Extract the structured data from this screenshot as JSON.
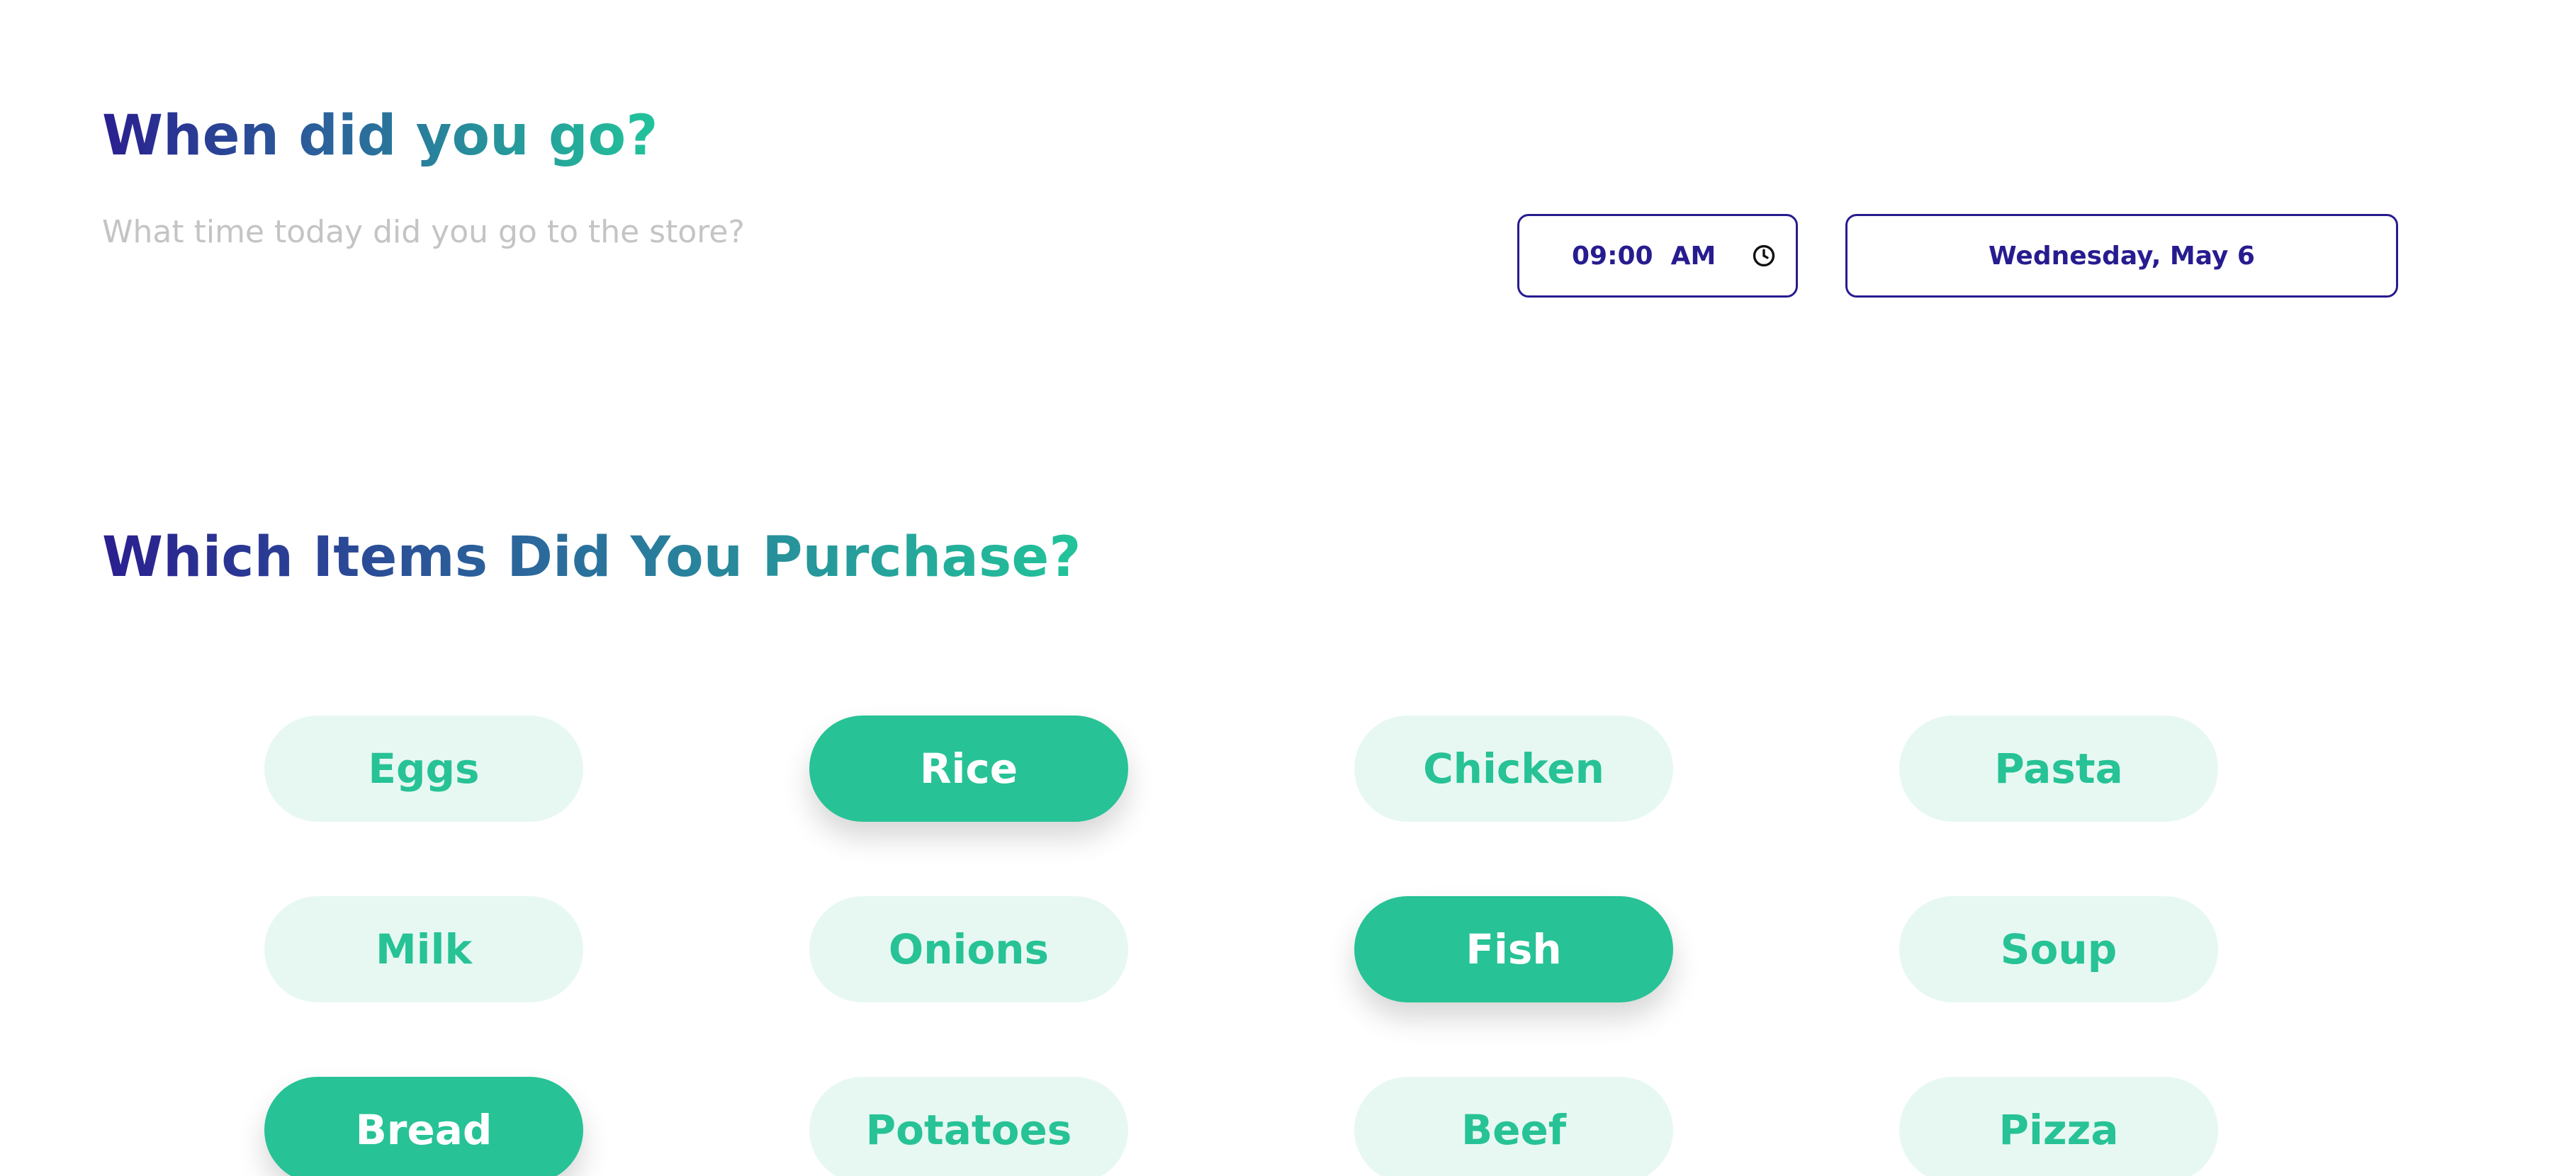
{
  "visit": {
    "heading": "When did you go?",
    "subtitle": "What time today did you go to the store?",
    "time_value": "09:00  AM",
    "time_icon": "clock-icon",
    "date_value": "Wednesday, May 6"
  },
  "purchase": {
    "heading": "Which Items Did You Purchase?",
    "items": [
      {
        "label": "Eggs",
        "selected": false
      },
      {
        "label": "Rice",
        "selected": true
      },
      {
        "label": "Chicken",
        "selected": false
      },
      {
        "label": "Pasta",
        "selected": false
      },
      {
        "label": "Milk",
        "selected": false
      },
      {
        "label": "Onions",
        "selected": false
      },
      {
        "label": "Fish",
        "selected": true
      },
      {
        "label": "Soup",
        "selected": false
      },
      {
        "label": "Bread",
        "selected": true
      },
      {
        "label": "Potatoes",
        "selected": false
      },
      {
        "label": "Beef",
        "selected": false
      },
      {
        "label": "Pizza",
        "selected": false
      }
    ]
  },
  "colors": {
    "primary": "#271c8f",
    "accent": "#27c295",
    "chip_unselected_bg": "#e7f8f2",
    "subtitle": "#c4c4c4"
  }
}
